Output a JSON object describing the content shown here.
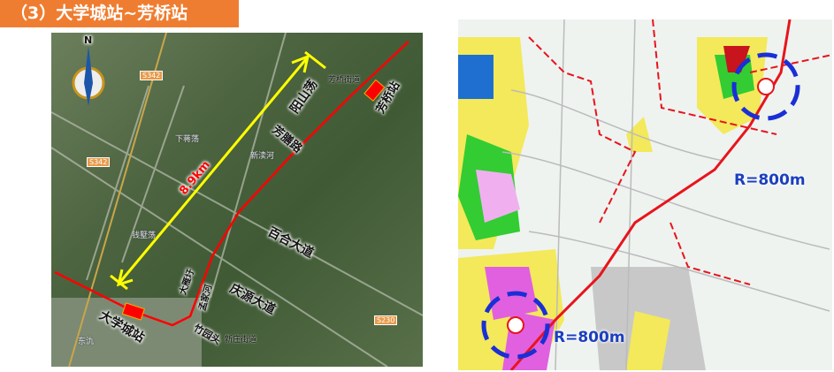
{
  "title": "（3）大学城站~芳桥站",
  "left_map": {
    "compass": "N",
    "distance": "8.9km",
    "stations": {
      "start": "大学城站",
      "end": "芳桥站"
    },
    "roads": [
      "芳膳路",
      "百合大道",
      "庆源大道",
      "大雁圩",
      "孟家河"
    ],
    "places": [
      "阳山荡",
      "竹园头"
    ],
    "base_labels": [
      "芳桥街道",
      "新庄街道",
      "下蒋荡",
      "新渎河",
      "钱墅荡",
      "东氿"
    ],
    "shields": [
      "S342",
      "S342",
      "S230"
    ],
    "colors": {
      "line": "#ff0000",
      "measure": "#ffff00",
      "station": "#ff0000"
    }
  },
  "right_map": {
    "radius_labels": [
      "R=800m",
      "R=800m"
    ],
    "colors": {
      "line": "#e8141c",
      "circle": "#1a2fd6"
    }
  }
}
